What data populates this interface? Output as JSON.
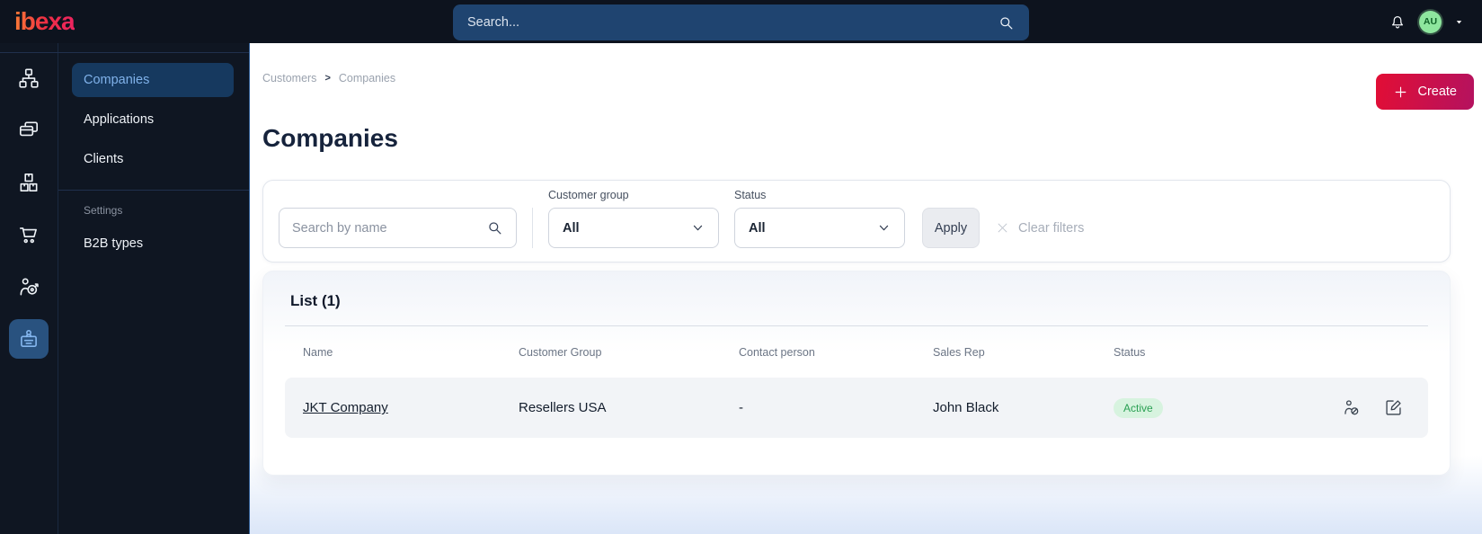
{
  "topbar": {
    "logo_text": "ibexa",
    "search_placeholder": "Search...",
    "avatar_initials": "AU"
  },
  "sidebar": {
    "menu_items": [
      {
        "label": "Companies",
        "active": true
      },
      {
        "label": "Applications",
        "active": false
      },
      {
        "label": "Clients",
        "active": false
      }
    ],
    "section_label": "Settings",
    "section_items": [
      {
        "label": "B2B types"
      }
    ]
  },
  "header": {
    "breadcrumb": [
      "Customers",
      "Companies"
    ],
    "separator": ">",
    "title": "Companies",
    "create_label": "Create"
  },
  "filters": {
    "name_placeholder": "Search by name",
    "customer_group_label": "Customer group",
    "customer_group_value": "All",
    "status_label": "Status",
    "status_value": "All",
    "apply_label": "Apply",
    "clear_label": "Clear filters"
  },
  "list": {
    "title": "List (1)",
    "columns": [
      "Name",
      "Customer Group",
      "Contact person",
      "Sales Rep",
      "Status"
    ],
    "rows": [
      {
        "name": "JKT Company",
        "customer_group": "Resellers USA",
        "contact_person": "-",
        "sales_rep": "John Black",
        "status": "Active"
      }
    ]
  },
  "colors": {
    "topbar_bg": "#0d131e",
    "topbar_search_bg": "#1f4470",
    "active_menu_bg": "#16395f",
    "active_menu_text": "#80b2ea",
    "create_gradient_start": "#e20e35",
    "create_gradient_end": "#b4125f",
    "status_active_bg": "#d7f3df",
    "status_active_text": "#2aa053",
    "avatar_bg": "#8ee69e",
    "row_bg": "#f2f4f7"
  }
}
